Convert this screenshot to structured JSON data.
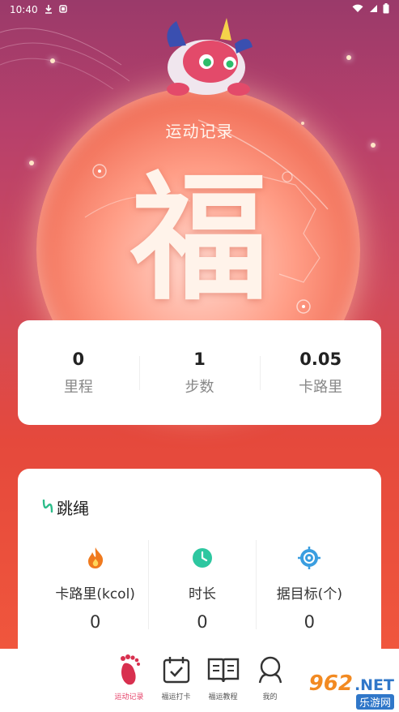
{
  "status_bar": {
    "time": "10:40"
  },
  "hero": {
    "title": "运动记录",
    "fu_character": "福"
  },
  "stats": [
    {
      "value": "0",
      "label": "里程"
    },
    {
      "value": "1",
      "label": "步数"
    },
    {
      "value": "0.05",
      "label": "卡路里"
    }
  ],
  "activity": {
    "title": "跳绳",
    "metrics": [
      {
        "icon": "flame-icon",
        "label": "卡路里(kcol)",
        "value": "0"
      },
      {
        "icon": "clock-icon",
        "label": "时长",
        "value": "0"
      },
      {
        "icon": "target-icon",
        "label": "据目标(个)",
        "value": "0"
      }
    ]
  },
  "tabbar": {
    "items": [
      {
        "label": "运动记录",
        "icon": "footprint-icon",
        "active": true
      },
      {
        "label": "福运打卡",
        "icon": "calendar-check-icon",
        "active": false
      },
      {
        "label": "福运教程",
        "icon": "book-icon",
        "active": false
      },
      {
        "label": "我的",
        "icon": "user-icon",
        "active": false
      }
    ]
  },
  "watermark": {
    "number": "962",
    "suffix": ".NET",
    "subtitle": "乐游网"
  },
  "colors": {
    "accent": "#e6436a",
    "card_bg": "#ffffff",
    "flame": "#f07a1e",
    "clock": "#2dc7a0",
    "target": "#3a9ee0"
  }
}
